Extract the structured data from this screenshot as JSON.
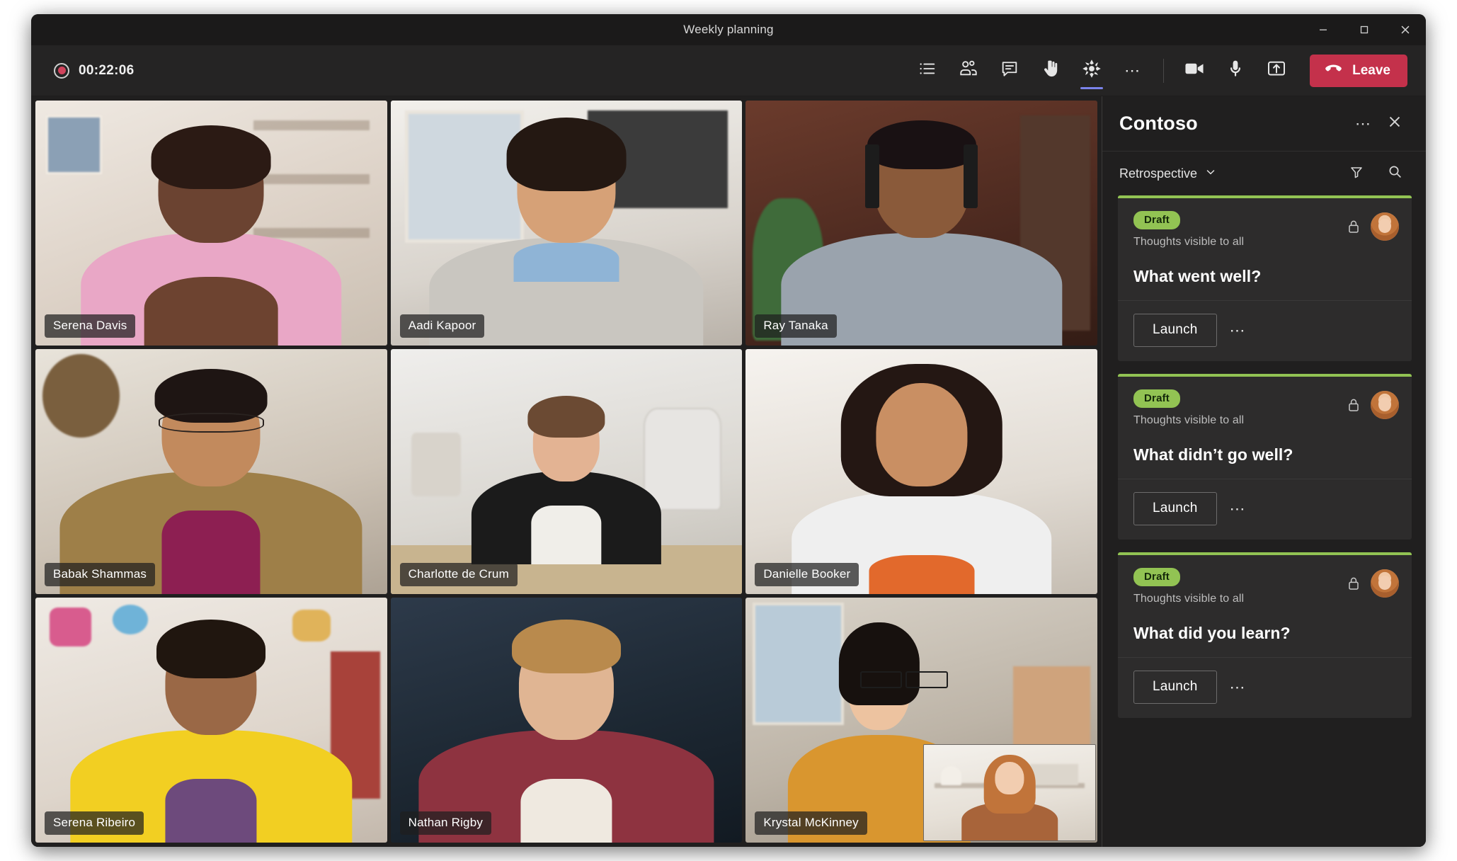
{
  "window": {
    "title": "Weekly planning",
    "controls": [
      {
        "name": "minimize",
        "glyph": "minimize-icon"
      },
      {
        "name": "maximize",
        "glyph": "maximize-icon"
      },
      {
        "name": "close",
        "glyph": "close-icon"
      }
    ]
  },
  "toolbar": {
    "recording_timer": "00:22:06",
    "record_icon": "record-icon",
    "actions": [
      {
        "name": "meeting-notes",
        "icon": "list-icon",
        "label": "Show meeting notes",
        "active": false
      },
      {
        "name": "participants",
        "icon": "people-icon",
        "label": "Show participants",
        "active": false
      },
      {
        "name": "chat",
        "icon": "chat-icon",
        "label": "Show conversation",
        "active": false
      },
      {
        "name": "raise-hand",
        "icon": "raise-hand-icon",
        "label": "Raise your hand",
        "active": false
      },
      {
        "name": "app",
        "icon": "app-pinwheel-icon",
        "label": "Contoso app",
        "active": true
      },
      {
        "name": "more-options",
        "icon": "more-options-icon",
        "label": "More actions",
        "active": false
      },
      {
        "name": "camera",
        "icon": "camera-icon",
        "label": "Turn camera off",
        "active": false
      },
      {
        "name": "microphone",
        "icon": "microphone-icon",
        "label": "Mute",
        "active": false
      },
      {
        "name": "share",
        "icon": "share-screen-icon",
        "label": "Share content",
        "active": false
      }
    ],
    "leave_label": "Leave",
    "leave_icon": "hangup-icon",
    "leave_color": "#c4314b"
  },
  "video_grid": {
    "tiles": [
      {
        "name": "Serena Davis",
        "scene": "bg-office"
      },
      {
        "name": "Aadi Kapoor",
        "scene": "bg-study"
      },
      {
        "name": "Ray Tanaka",
        "scene": "bg-brick"
      },
      {
        "name": "Babak Shammas",
        "scene": "bg-home"
      },
      {
        "name": "Charlotte de Crum",
        "scene": "bg-meeting"
      },
      {
        "name": "Danielle Booker",
        "scene": "bg-white"
      },
      {
        "name": "Serena Ribeiro",
        "scene": "bg-craft"
      },
      {
        "name": "Nathan Rigby",
        "scene": "bg-dark"
      },
      {
        "name": "Krystal McKinney",
        "scene": "bg-closet"
      }
    ],
    "self_view_present": true
  },
  "side_panel": {
    "title": "Contoso",
    "more_icon": "more-options-icon",
    "close_icon": "close-icon",
    "board_name": "Retrospective",
    "board_chevron_icon": "chevron-down-icon",
    "filter_icon": "filter-icon",
    "search_icon": "search-icon",
    "accent_color": "#92c353",
    "cards": [
      {
        "badge": "Draft",
        "subtitle": "Thoughts visible to all",
        "title": "What went well?",
        "lock_icon": "lock-icon",
        "avatar": "avatar",
        "action_label": "Launch",
        "more_icon": "more-options-icon"
      },
      {
        "badge": "Draft",
        "subtitle": "Thoughts visible to all",
        "title": "What didn’t go well?",
        "lock_icon": "lock-icon",
        "avatar": "avatar",
        "action_label": "Launch",
        "more_icon": "more-options-icon"
      },
      {
        "badge": "Draft",
        "subtitle": "Thoughts visible to all",
        "title": "What did you learn?",
        "lock_icon": "lock-icon",
        "avatar": "avatar",
        "action_label": "Launch",
        "more_icon": "more-options-icon"
      }
    ]
  }
}
